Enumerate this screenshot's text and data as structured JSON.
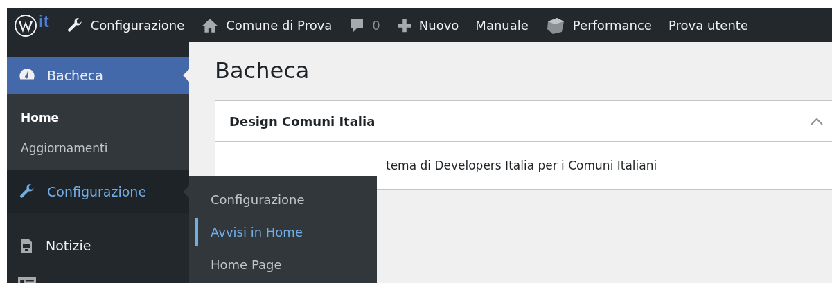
{
  "top_bar": {
    "logo_text": "it",
    "items": [
      {
        "kind": "wrench",
        "label": "Configurazione"
      },
      {
        "kind": "home",
        "label": "Comune di Prova"
      },
      {
        "kind": "comment",
        "label": "0"
      },
      {
        "kind": "plus",
        "label": "Nuovo"
      },
      {
        "kind": "none",
        "label": "Manuale"
      },
      {
        "kind": "cube",
        "label": "Performance"
      },
      {
        "kind": "none",
        "label": "Prova utente"
      }
    ]
  },
  "sidebar": {
    "items": [
      {
        "kind": "dashboard",
        "label": "Bacheca",
        "selected": true,
        "children": [
          {
            "label": "Home",
            "selected": true
          },
          {
            "label": "Aggiornamenti",
            "selected": false
          }
        ]
      },
      {
        "kind": "wrench",
        "label": "Configurazione",
        "selected": false,
        "hovered": true
      },
      {
        "kind": "document",
        "label": "Notizie",
        "selected": false
      },
      {
        "kind": "card",
        "selected": false
      }
    ]
  },
  "flyout": {
    "items": [
      {
        "label": "Configurazione",
        "selected": false
      },
      {
        "label": "Avvisi in Home",
        "selected": true
      },
      {
        "label": "Home Page",
        "selected": false
      }
    ]
  },
  "page": {
    "title": "Bacheca",
    "panel": {
      "title": "Design Comuni Italia",
      "expanded": true,
      "body": "tema di Developers Italia per i Comuni Italiani"
    }
  }
}
